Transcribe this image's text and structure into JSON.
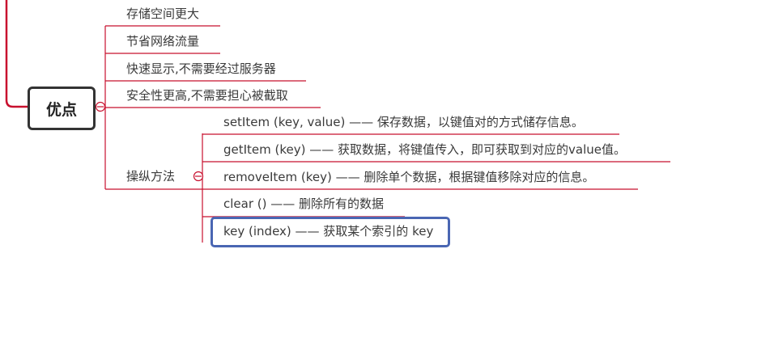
{
  "root": {
    "label": "优点"
  },
  "advantages": [
    "存储空间更大",
    "节省网络流量",
    "快速显示,不需要经过服务器",
    "安全性更高,不需要担心被截取"
  ],
  "methods_branch": {
    "label": "操纵方法",
    "items": [
      "setItem (key, value) —— 保存数据，以键值对的方式储存信息。",
      "getItem (key) —— 获取数据，将键值传入，即可获取到对应的value值。",
      "removeItem (key) —— 删除单个数据，根据键值移除对应的信息。",
      "clear () —— 删除所有的数据",
      "key (index) —— 获取某个索引的 key"
    ]
  },
  "colors": {
    "branch_line": "#c8102e",
    "highlight_border": "#4a66b3",
    "root_border": "#333333"
  }
}
